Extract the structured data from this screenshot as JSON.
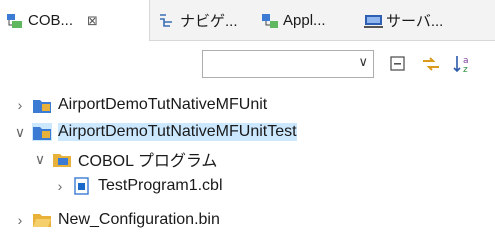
{
  "tabs": [
    {
      "label": "COB...",
      "close": "⊠",
      "icon": "project-explorer-icon"
    },
    {
      "label": "ナビゲ...",
      "icon": "navigator-icon"
    },
    {
      "label": "Appl...",
      "icon": "application-explorer-icon"
    },
    {
      "label": "サーバ...",
      "icon": "server-icon"
    }
  ],
  "toolbar": {
    "filter_value": "",
    "dropdown_glyph": "∨",
    "buttons": [
      "collapse-all-icon",
      "link-with-editor-icon",
      "sort-icon"
    ]
  },
  "tree": [
    {
      "label": "AirportDemoTutNativeMFUnit",
      "twisty": "›",
      "icon": "cobol-project-icon"
    },
    {
      "label": "AirportDemoTutNativeMFUnitTest",
      "twisty": "∨",
      "icon": "cobol-project-icon"
    },
    {
      "label": "COBOL プログラム",
      "twisty": "∨",
      "icon": "cobol-programs-folder-icon"
    },
    {
      "label": "TestProgram1.cbl",
      "twisty": "›",
      "icon": "cobol-file-icon"
    },
    {
      "label": "New_Configuration.bin",
      "twisty": "›",
      "icon": "folder-icon"
    }
  ],
  "colors": {
    "accent": "#1b6ac9",
    "folder": "#e8b23a",
    "selection": "#cce8ff"
  }
}
